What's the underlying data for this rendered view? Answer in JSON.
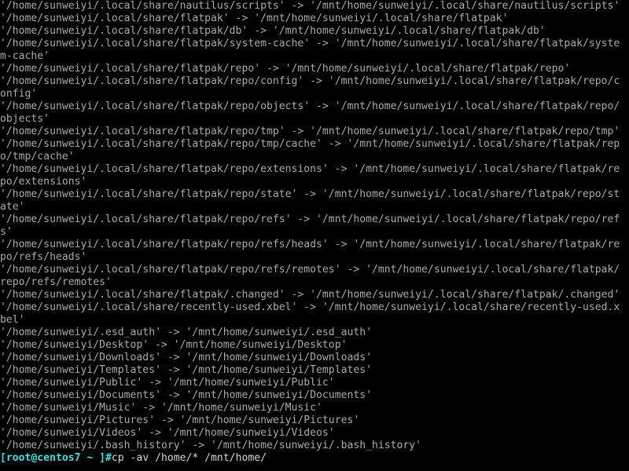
{
  "terminal": {
    "title": "root@centos7:~",
    "background_color": "#000000",
    "foreground_color": "#aaaaaa",
    "prompt_color": "#2ee6e6",
    "columns": 100,
    "rows": 38,
    "font_size_px": 13,
    "line_height_px": 16,
    "command_history": [
      "cp -av /home/* /mnt/home/"
    ],
    "output_lines": [
      "'/home/sunweiyi/.local/share/nautilus/scripts' -> '/mnt/home/sunweiyi/.local/share/nautilus/scripts'",
      "'/home/sunweiyi/.local/share/flatpak' -> '/mnt/home/sunweiyi/.local/share/flatpak'",
      "'/home/sunweiyi/.local/share/flatpak/db' -> '/mnt/home/sunweiyi/.local/share/flatpak/db'",
      "'/home/sunweiyi/.local/share/flatpak/system-cache' -> '/mnt/home/sunweiyi/.local/share/flatpak/system-cache'",
      "'/home/sunweiyi/.local/share/flatpak/repo' -> '/mnt/home/sunweiyi/.local/share/flatpak/repo'",
      "'/home/sunweiyi/.local/share/flatpak/repo/config' -> '/mnt/home/sunweiyi/.local/share/flatpak/repo/config'",
      "'/home/sunweiyi/.local/share/flatpak/repo/objects' -> '/mnt/home/sunweiyi/.local/share/flatpak/repo/objects'",
      "'/home/sunweiyi/.local/share/flatpak/repo/tmp' -> '/mnt/home/sunweiyi/.local/share/flatpak/repo/tmp'",
      "'/home/sunweiyi/.local/share/flatpak/repo/tmp/cache' -> '/mnt/home/sunweiyi/.local/share/flatpak/repo/tmp/cache'",
      "'/home/sunweiyi/.local/share/flatpak/repo/extensions' -> '/mnt/home/sunweiyi/.local/share/flatpak/repo/extensions'",
      "'/home/sunweiyi/.local/share/flatpak/repo/state' -> '/mnt/home/sunweiyi/.local/share/flatpak/repo/state'",
      "'/home/sunweiyi/.local/share/flatpak/repo/refs' -> '/mnt/home/sunweiyi/.local/share/flatpak/repo/refs'",
      "'/home/sunweiyi/.local/share/flatpak/repo/refs/heads' -> '/mnt/home/sunweiyi/.local/share/flatpak/repo/refs/heads'",
      "'/home/sunweiyi/.local/share/flatpak/repo/refs/remotes' -> '/mnt/home/sunweiyi/.local/share/flatpak/repo/refs/remotes'",
      "'/home/sunweiyi/.local/share/flatpak/.changed' -> '/mnt/home/sunweiyi/.local/share/flatpak/.changed'",
      "'/home/sunweiyi/.local/share/recently-used.xbel' -> '/mnt/home/sunweiyi/.local/share/recently-used.xbel'",
      "'/home/sunweiyi/.esd_auth' -> '/mnt/home/sunweiyi/.esd_auth'",
      "'/home/sunweiyi/Desktop' -> '/mnt/home/sunweiyi/Desktop'",
      "'/home/sunweiyi/Downloads' -> '/mnt/home/sunweiyi/Downloads'",
      "'/home/sunweiyi/Templates' -> '/mnt/home/sunweiyi/Templates'",
      "'/home/sunweiyi/Public' -> '/mnt/home/sunweiyi/Public'",
      "'/home/sunweiyi/Documents' -> '/mnt/home/sunweiyi/Documents'",
      "'/home/sunweiyi/Music' -> '/mnt/home/sunweiyi/Music'",
      "'/home/sunweiyi/Pictures' -> '/mnt/home/sunweiyi/Pictures'",
      "'/home/sunweiyi/Videos' -> '/mnt/home/sunweiyi/Videos'",
      "'/home/sunweiyi/.bash_history' -> '/mnt/home/sunweiyi/.bash_history'"
    ],
    "prompt": {
      "text": "[root@centos7 ~ ]#",
      "user": "root",
      "host": "centos7",
      "cwd": "~",
      "sigil": "#",
      "command": "cp -av /home/* /mnt/home/"
    }
  }
}
